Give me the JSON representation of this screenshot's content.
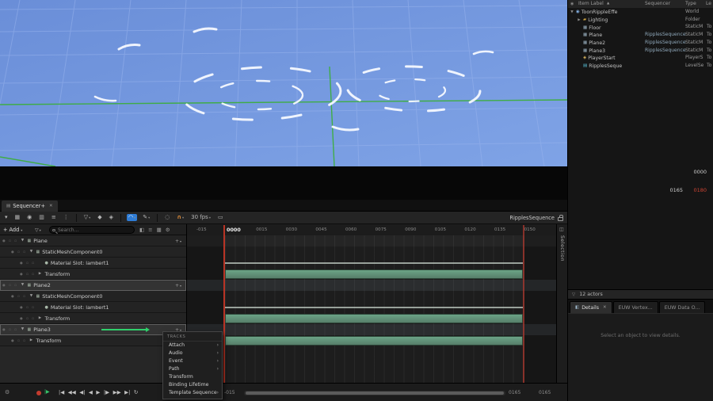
{
  "icons": {
    "close": "✕",
    "caret": "▾",
    "gear": "⚙",
    "funnel": "▽",
    "menu_arrow": "›",
    "sort_asc": "▲",
    "plus": "+",
    "clapper": "▤",
    "panel": "◫",
    "range_green": "|▶",
    "details": "◧",
    "header_item": "◉",
    "track_toggles": "● ▫ ▫"
  },
  "transport": [
    {
      "name": "to-front-icon",
      "glyph": "|◀"
    },
    {
      "name": "fast-rewind-icon",
      "glyph": "◀◀"
    },
    {
      "name": "step-back-icon",
      "glyph": "◀|"
    },
    {
      "name": "play-reverse-icon",
      "glyph": "◀"
    },
    {
      "name": "play-icon",
      "glyph": "▶"
    },
    {
      "name": "step-forward-icon",
      "glyph": "|▶"
    },
    {
      "name": "fast-forward-icon",
      "glyph": "▶▶"
    },
    {
      "name": "to-end-icon",
      "glyph": "▶|"
    },
    {
      "name": "loop-icon",
      "glyph": "↻"
    }
  ],
  "outliner": {
    "header": {
      "item_label": "Item Label",
      "sequencer": "Sequencer",
      "type": "Type",
      "level": "Le"
    },
    "rows": [
      {
        "expander": "▼",
        "icon": "world-icon",
        "glyph": "◉",
        "label": "ToonRippleEffe",
        "sequencer": "",
        "type": "World",
        "level": "",
        "indent": 0
      },
      {
        "expander": "▶",
        "icon": "folder-icon",
        "glyph": "▰",
        "label": "Lighting",
        "sequencer": "",
        "type": "Folder",
        "level": "",
        "indent": 1
      },
      {
        "expander": "",
        "icon": "mesh-icon",
        "glyph": "▦",
        "label": "Floor",
        "sequencer": "",
        "type": "StaticM",
        "level": "To",
        "indent": 1
      },
      {
        "expander": "",
        "icon": "mesh-icon",
        "glyph": "▦",
        "label": "Plane",
        "sequencer": "RipplesSequence",
        "type": "StaticM",
        "level": "To",
        "indent": 1
      },
      {
        "expander": "",
        "icon": "mesh-icon",
        "glyph": "▦",
        "label": "Plane2",
        "sequencer": "RipplesSequence",
        "type": "StaticM",
        "level": "To",
        "indent": 1
      },
      {
        "expander": "",
        "icon": "mesh-icon",
        "glyph": "▦",
        "label": "Plane3",
        "sequencer": "RipplesSequence",
        "type": "StaticM",
        "level": "To",
        "indent": 1
      },
      {
        "expander": "",
        "icon": "player-start-icon",
        "glyph": "◈",
        "label": "PlayerStart",
        "sequencer": "",
        "type": "PlayerS",
        "level": "To",
        "indent": 1
      },
      {
        "expander": "",
        "icon": "level-sequence-icon",
        "glyph": "▤",
        "label": "RipplesSeque",
        "sequencer": "",
        "type": "LevelSe",
        "level": "To",
        "indent": 1
      }
    ]
  },
  "readouts": {
    "current_frame": "0000",
    "range_end": "0165",
    "total_frames": "0180"
  },
  "sequencer": {
    "tab_label": "Sequencer+",
    "toolbar": {
      "title": "RipplesSequence",
      "fps_label": "30 fps",
      "icons": [
        {
          "name": "options-caret-icon",
          "glyph": "▾"
        },
        {
          "name": "save-icon",
          "glyph": "▦"
        },
        {
          "name": "camera-icon",
          "glyph": "◉"
        },
        {
          "name": "render-movie-icon",
          "glyph": "▥"
        },
        {
          "name": "playback-options-icon",
          "glyph": "≡"
        },
        {
          "name": "more-icon",
          "glyph": "⋮"
        },
        {
          "sep": true
        },
        {
          "name": "filter-tracks-icon",
          "glyph": "▽",
          "caret": true
        },
        {
          "name": "key-all-icon",
          "glyph": "◆"
        },
        {
          "name": "key-channels-icon",
          "glyph": "◈"
        },
        {
          "sep": true
        },
        {
          "name": "curve-editor-icon",
          "glyph": "◠",
          "active": true,
          "caret": true
        },
        {
          "name": "paint-keys-icon",
          "glyph": "✎",
          "caret": true
        },
        {
          "sep": true
        },
        {
          "name": "auto-key-icon",
          "glyph": "◌"
        },
        {
          "name": "snap-magnet-icon",
          "glyph": "∩",
          "orange": true,
          "caret": true
        },
        {
          "name": "fps-dropdown",
          "bind": "sequencer.toolbar.fps_label",
          "caret": true
        },
        {
          "name": "thumbnail-icon",
          "glyph": "▭"
        }
      ]
    },
    "controls": {
      "add_label": "Add",
      "search_placeholder": "Search...",
      "view_icons": [
        {
          "name": "expand-tracks-icon",
          "glyph": "◧"
        },
        {
          "name": "list-options-icon",
          "glyph": "≡"
        },
        {
          "name": "render-grid-icon",
          "glyph": "▦"
        },
        {
          "name": "track-settings-icon",
          "glyph": "⚙"
        }
      ]
    },
    "playhead_label": "0000",
    "ruler_labels": [
      "-015",
      "0015",
      "0030",
      "0045",
      "0060",
      "0075",
      "0090",
      "0105",
      "0120",
      "0135",
      "0150"
    ],
    "tracks": [
      {
        "label": "Plane",
        "indent": 0,
        "expander": "▼",
        "glyph": "▦",
        "toplevel": true,
        "selected": false
      },
      {
        "label": "StaticMeshComponent0",
        "indent": 1,
        "expander": "▼",
        "glyph": "▦"
      },
      {
        "label": "Material Slot: lambert1",
        "indent": 2,
        "expander": "",
        "glyph": "●"
      },
      {
        "label": "Transform",
        "indent": 2,
        "expander": "▶",
        "glyph": ""
      },
      {
        "label": "Plane2",
        "indent": 0,
        "expander": "▼",
        "glyph": "▦",
        "toplevel": true,
        "selected": true
      },
      {
        "label": "StaticMeshComponent0",
        "indent": 1,
        "expander": "▼",
        "glyph": "▦"
      },
      {
        "label": "Material Slot: lambert1",
        "indent": 2,
        "expander": "",
        "glyph": "●"
      },
      {
        "label": "Transform",
        "indent": 2,
        "expander": "▶",
        "glyph": ""
      },
      {
        "label": "Plane3",
        "indent": 0,
        "expander": "▼",
        "glyph": "▦",
        "toplevel": true,
        "selected": true,
        "drag_arrow": true
      },
      {
        "label": "Transform",
        "indent": 1,
        "expander": "▶",
        "glyph": ""
      }
    ],
    "sections": [
      {
        "track": 2,
        "kind": "thin",
        "start": 0,
        "end": 150
      },
      {
        "track": 3,
        "kind": "bar",
        "start": 0,
        "end": 150
      },
      {
        "track": 6,
        "kind": "thin",
        "start": 0,
        "end": 150
      },
      {
        "track": 7,
        "kind": "bar",
        "start": 0,
        "end": 150
      },
      {
        "track": 9,
        "kind": "bar",
        "start": 0,
        "end": 150
      }
    ],
    "footer": {
      "range_start": "-015",
      "range_end": "0165",
      "range_total": "0165"
    },
    "selection_tab": "Selection"
  },
  "context_menu": {
    "header": "TRACKS",
    "items": [
      {
        "label": "Attach",
        "submenu": true
      },
      {
        "label": "Audio",
        "submenu": true
      },
      {
        "label": "Event",
        "submenu": true
      },
      {
        "label": "Path",
        "submenu": true
      },
      {
        "label": "Transform",
        "submenu": false
      },
      {
        "label": "Binding Lifetime",
        "submenu": false
      },
      {
        "label": "Template Sequence",
        "submenu": true
      }
    ]
  },
  "details": {
    "actors_count": "12 actors",
    "tabs": [
      {
        "label": "Details",
        "closable": true
      },
      {
        "label": "EUW Vertex..."
      },
      {
        "label": "EUW Data O..."
      }
    ],
    "empty_message": "Select an object to view details."
  },
  "colors": {
    "accent_blue": "#2e7cd6",
    "snap_orange": "#e8913a",
    "section_green": "#5e947c",
    "playhead_red": "#b93425",
    "axis_green": "#3dae3d",
    "viewport_blue": "#7296dc"
  }
}
